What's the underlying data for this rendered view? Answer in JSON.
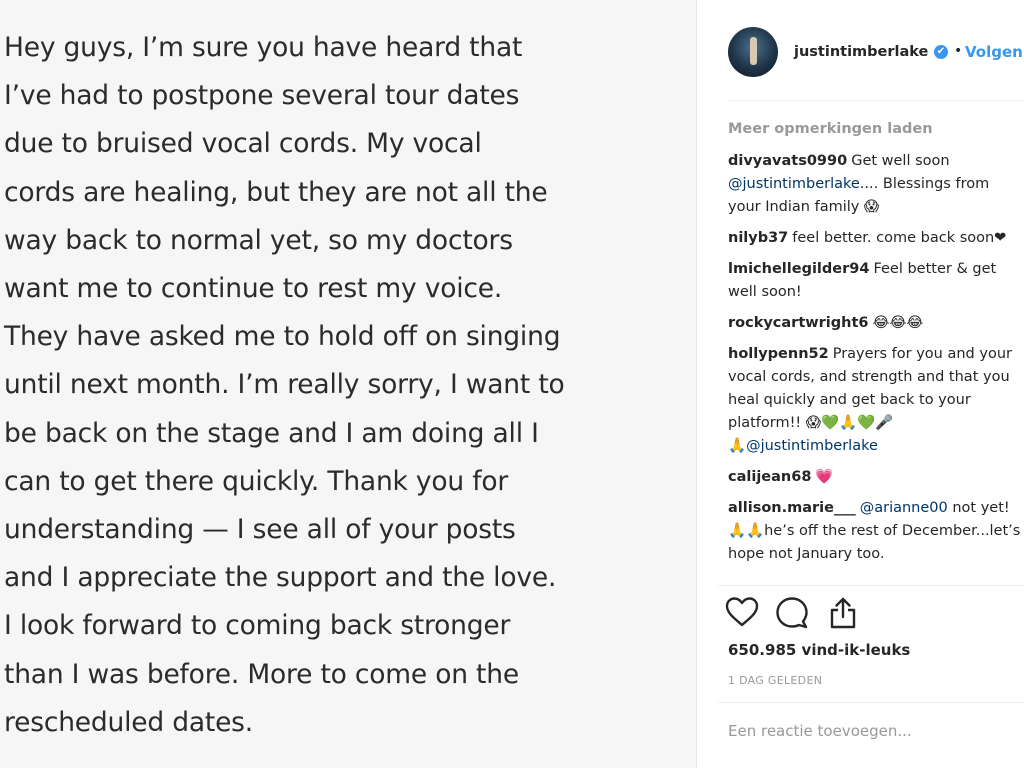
{
  "post": {
    "image_lines": [
      "Hey guys, I’m sure you have heard that",
      "I’ve had to postpone several tour dates",
      "due to bruised vocal cords. My vocal",
      "cords are healing, but they are not all the",
      "way back to normal yet, so my doctors",
      "want me to continue to rest my voice.",
      "They have asked me to hold off on singing",
      "until next month. I’m really sorry, I want to",
      "be back on the stage and I am doing all I",
      "can to get there quickly. Thank you for",
      "understanding — I see all of your posts",
      "and I appreciate the support and the love.",
      "I look forward to coming back stronger",
      "than I was before. More to come on the",
      "rescheduled dates."
    ]
  },
  "header": {
    "username": "justintimberlake",
    "verified_symbol": "✔",
    "separator": "•",
    "follow_label": "Volgen"
  },
  "comments": {
    "load_more_label": "Meer opmerkingen laden",
    "items": [
      {
        "user": "divyavats0990",
        "text": "Get well soon",
        "mention": "@justintimberlake",
        "text2": ".... Blessings from",
        "text3": "your Indian family 😱"
      },
      {
        "user": "nilyb37",
        "text": "feel better. come back soon❤"
      },
      {
        "user": "lmichellegilder94",
        "text": "Feel better & get",
        "text2": "well soon!"
      },
      {
        "user": "rockycartwright6",
        "text": "😂😂😂"
      },
      {
        "user": "hollypenn52",
        "text": "Prayers for you and your",
        "text2": "vocal cords, and strength and that you",
        "text3": "heal quickly and get back to your",
        "text4": "platform!! 😱💚🙏💚🎤",
        "mention": "@justintimberlake",
        "mention_prefix": "🙏"
      },
      {
        "user": "calijean68",
        "text": "💗"
      },
      {
        "user": "allison.marie___",
        "mention": "@arianne00",
        "text": "not yet!",
        "text2": "🙏🙏he’s off the rest of December...let’s",
        "text3": "hope not January too."
      }
    ]
  },
  "actions": {
    "like_icon": "heart-outline",
    "comment_icon": "speech-bubble-outline",
    "share_icon": "share-upload"
  },
  "likes_label": "650.985 vind-ik-leuks",
  "time_label": "1 DAG GELEDEN",
  "add_comment_placeholder": "Een reactie toevoegen..."
}
